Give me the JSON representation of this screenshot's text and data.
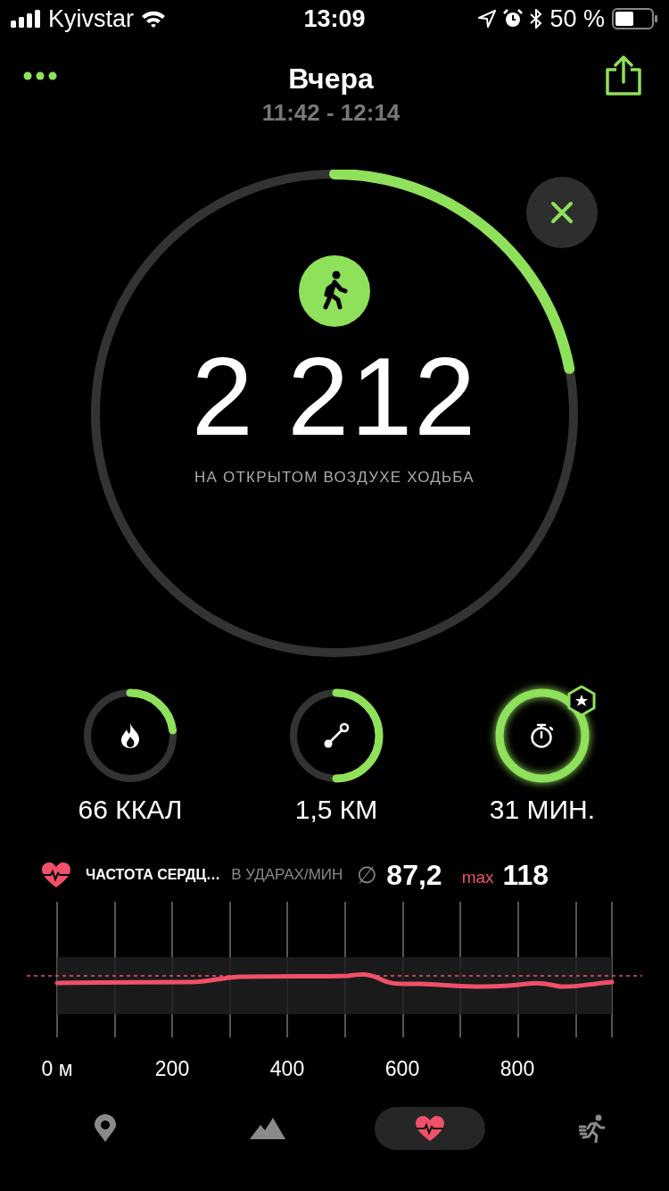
{
  "status_bar": {
    "carrier": "Kyivstar",
    "time": "13:09",
    "battery": "50 %"
  },
  "header": {
    "title": "Вчера",
    "subtitle": "11:42 - 12:14"
  },
  "goal_ring": {
    "level": 0.22,
    "value": "2 212",
    "label": "НА ОТКРЫТОМ ВОЗДУХЕ ХОДЬБА"
  },
  "stats": [
    {
      "kind": "calories",
      "level": 0.23,
      "value": "66 ККАЛ",
      "achieved": false
    },
    {
      "kind": "distance",
      "level": 0.5,
      "value": "1,5 КМ",
      "achieved": false
    },
    {
      "kind": "duration",
      "level": 1,
      "value": "31 МИН.",
      "achieved": true
    }
  ],
  "heart_rate": {
    "title": "ЧАСТОТА СЕРДЦ…",
    "unit": "В УДАРАХ/МИН",
    "avg_symbol": "∅",
    "average": "87,2",
    "max_label": "max",
    "max": "118",
    "x_labels": [
      "0 м",
      "200",
      "400",
      "600",
      "800"
    ]
  },
  "tabs": [
    {
      "kind": "map",
      "selected": false
    },
    {
      "kind": "elevation",
      "selected": false
    },
    {
      "kind": "heart",
      "selected": true
    },
    {
      "kind": "run",
      "selected": false
    }
  ]
}
